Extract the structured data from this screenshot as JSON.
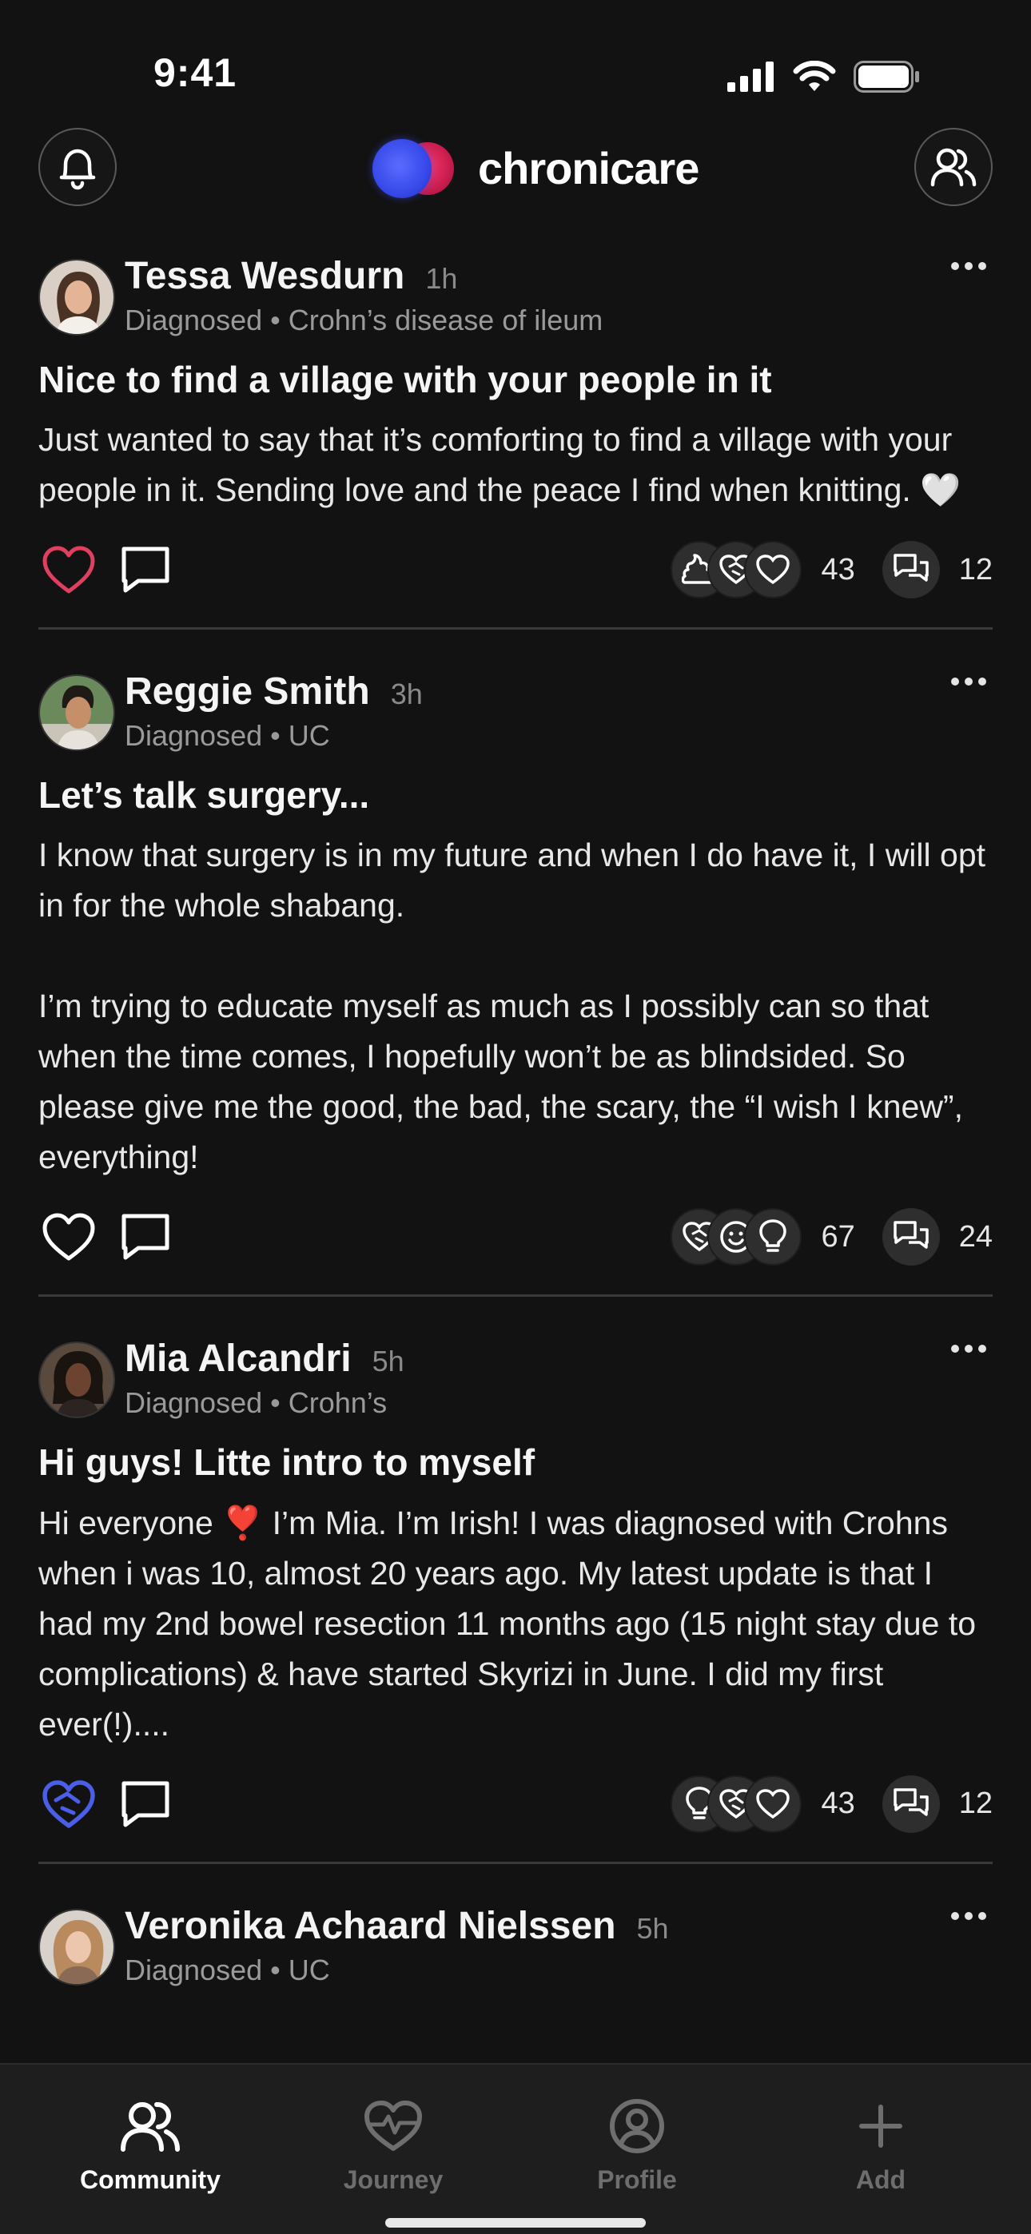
{
  "status_bar": {
    "time": "9:41"
  },
  "header": {
    "app_name": "chronicare"
  },
  "colors": {
    "accent_red": "#e0405f",
    "accent_blue": "#4a5ee8",
    "background": "#121212"
  },
  "posts": [
    {
      "author": "Tessa Wesdurn",
      "time": "1h",
      "diagnosis": "Diagnosed • Crohn’s disease of ileum",
      "title": "Nice to find a village with your people in it",
      "body": "Just wanted to say that it’s comforting to find a village with your people in it. Sending love and the peace I find when knitting. 🤍",
      "liked": true,
      "like_icon": "heart-filled-red-outline-icon",
      "reaction_icons": [
        "poop-icon",
        "heart-handshake-icon",
        "heart-icon"
      ],
      "reaction_count": "43",
      "comment_count": "12"
    },
    {
      "author": "Reggie Smith",
      "time": "3h",
      "diagnosis": "Diagnosed • UC",
      "title": "Let’s talk surgery...",
      "body": "I know that surgery is in my future and when I do have it, I will opt in for the whole shabang.\n\nI’m trying to educate myself as much as I possibly can so that when the time comes, I hopefully won’t be as blindsided. So please give me the good, the bad, the scary, the “I wish I knew”, everything!",
      "liked": false,
      "like_icon": "heart-outline-icon",
      "reaction_icons": [
        "heart-handshake-icon",
        "smile-icon",
        "lightbulb-icon"
      ],
      "reaction_count": "67",
      "comment_count": "24"
    },
    {
      "author": "Mia Alcandri",
      "time": "5h",
      "diagnosis": "Diagnosed • Crohn’s",
      "title": "Hi guys! Litte intro to myself",
      "body": "Hi everyone ❣️ I’m Mia. I’m Irish! I was diagnosed with Crohns when i was 10, almost 20 years ago. My latest update is that I had my 2nd bowel resection 11 months ago (15 night stay due to complications) & have started Skyrizi in June. I did my first ever(!)....",
      "liked": true,
      "like_icon": "heart-handshake-blue-icon",
      "reaction_icons": [
        "lightbulb-icon",
        "heart-handshake-icon",
        "heart-icon"
      ],
      "reaction_count": "43",
      "comment_count": "12"
    },
    {
      "author": "Veronika Achaard Nielssen",
      "time": "5h",
      "diagnosis": "Diagnosed • UC"
    }
  ],
  "bottom_nav": {
    "items": [
      {
        "label": "Community",
        "icon": "people-icon",
        "active": true
      },
      {
        "label": "Journey",
        "icon": "heartbeat-icon",
        "active": false
      },
      {
        "label": "Profile",
        "icon": "user-circle-icon",
        "active": false
      },
      {
        "label": "Add",
        "icon": "plus-icon",
        "active": false
      }
    ]
  }
}
